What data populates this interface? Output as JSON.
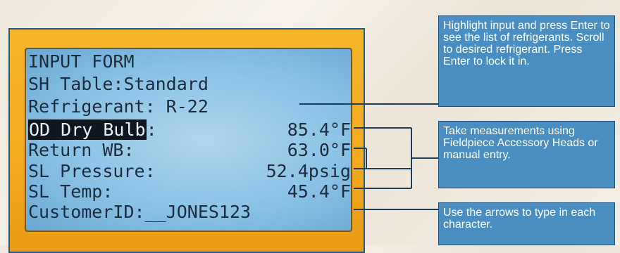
{
  "screen": {
    "lines": [
      {
        "label": "INPUT FORM",
        "value": ""
      },
      {
        "label": "SH Table:Standard",
        "value": ""
      },
      {
        "label": "Refrigerant: R-22",
        "value": ""
      },
      {
        "label": "OD Dry Bulb",
        "suffix": ":",
        "value": "85.4°F",
        "highlighted": true
      },
      {
        "label": "Return WB:",
        "value": "63.0°F"
      },
      {
        "label": "SL Pressure:",
        "value": "52.4psig"
      },
      {
        "label": "SL Temp:",
        "value": "45.4°F"
      },
      {
        "label": "CustomerID:__JONES123",
        "value": ""
      }
    ]
  },
  "callouts": {
    "select_refrigerant": "Highlight input and press Enter to see the list of refrigerants.  Scroll to desired refrigerant.  Press Enter to lock it in.",
    "measurements": "Take measurements using Fieldpiece Accessory Heads or manual entry.",
    "arrows": "Use the arrows to type in each character."
  },
  "colors": {
    "device_body": "#f2a91e",
    "lcd_background": "#8bc2e4",
    "callout_background": "#4a8ec2",
    "connector_line": "#1d3f5c"
  }
}
